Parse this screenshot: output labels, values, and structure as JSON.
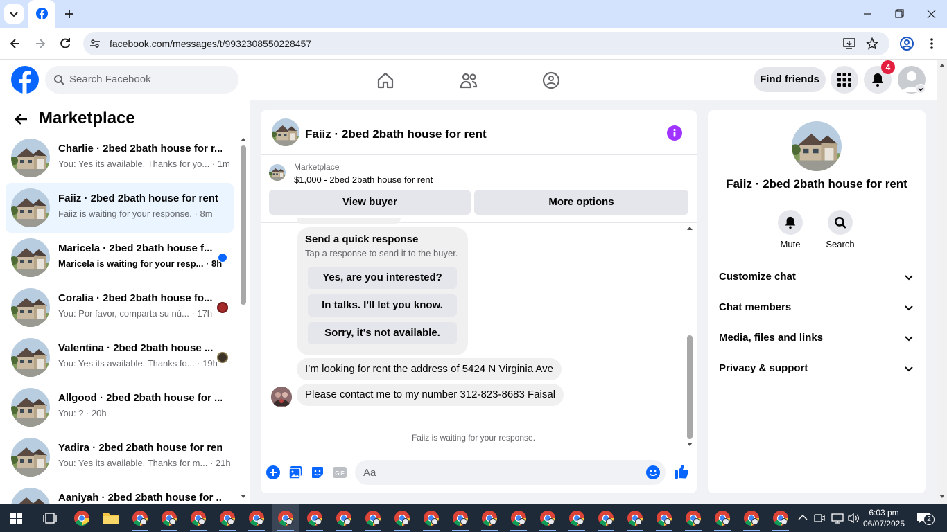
{
  "browser": {
    "url": "facebook.com/messages/t/9932308550228457"
  },
  "fb_header": {
    "search_placeholder": "Search Facebook",
    "find_friends": "Find friends",
    "notification_count": "4"
  },
  "left": {
    "title": "Marketplace",
    "conversations": [
      {
        "name": "Charlie · 2bed 2bath house for r...",
        "preview": "You: Yes its available. Thanks for yo... · 1m",
        "selected": false,
        "unread": false
      },
      {
        "name": "Faiiz · 2bed 2bath house for rent",
        "preview": "Faiiz is waiting for your response. · 8m",
        "selected": true,
        "unread": false
      },
      {
        "name": "Maricela · 2bed 2bath house f...",
        "preview": "Maricela is waiting for your resp... · 8h",
        "selected": false,
        "unread": true
      },
      {
        "name": "Coralia · 2bed 2bath house fo...",
        "preview": "You: Por favor, comparta su nú... · 17h",
        "selected": false,
        "unread": false
      },
      {
        "name": "Valentina · 2bed 2bath house ...",
        "preview": "You: Yes its available. Thanks fo... · 19h",
        "selected": false,
        "unread": false
      },
      {
        "name": "Allgood · 2bed 2bath house for ...",
        "preview": "You: ? · 20h",
        "selected": false,
        "unread": false
      },
      {
        "name": "Yadira · 2bed 2bath house for rent",
        "preview": "You: Yes its available. Thanks for m... · 21h",
        "selected": false,
        "unread": false
      },
      {
        "name": "Aaniyah · 2bed 2bath house for ...",
        "preview": "",
        "selected": false,
        "unread": false
      }
    ]
  },
  "chat": {
    "title": "Faiiz · 2bed 2bath house for rent",
    "listing_label": "Marketplace",
    "listing_price_title": "$1,000 - 2bed 2bath house for rent",
    "view_buyer": "View buyer",
    "more_options": "More options",
    "quick_title": "Send a quick response",
    "quick_sub": "Tap a response to send it to the buyer.",
    "quick_replies": [
      "Yes, are you interested?",
      "In talks. I'll let you know.",
      "Sorry, it's not available."
    ],
    "messages": [
      "I’m looking for rent the address of 5424 N Virginia Ave",
      "Please contact me to my number 312-823-8683 Faisal"
    ],
    "status": "Faiiz is waiting for your response.",
    "composer_placeholder": "Aa"
  },
  "right": {
    "title": "Faiiz · 2bed 2bath house for rent",
    "mute": "Mute",
    "search": "Search",
    "sections": [
      "Customize chat",
      "Chat members",
      "Media, files and links",
      "Privacy & support"
    ]
  },
  "taskbar": {
    "time": "6:03 pm",
    "date": "06/07/2025",
    "notif_badge": "2"
  },
  "colors": {
    "fb_blue": "#0866ff",
    "selected_bg": "#ebf5ff",
    "badge_red": "#e41e3f",
    "taskbar": "#1f2a38"
  }
}
